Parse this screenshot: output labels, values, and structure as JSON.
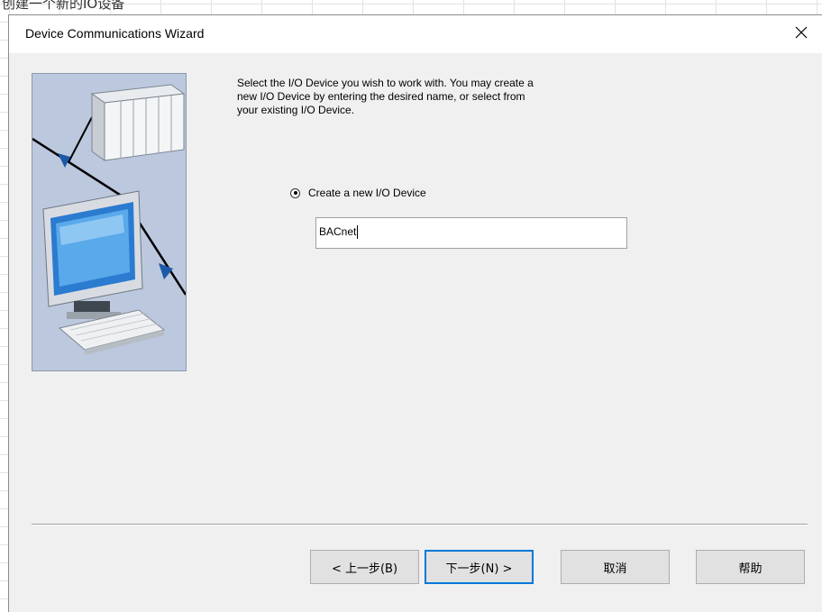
{
  "background": {
    "caption": "创建一个新的IO设备"
  },
  "dialog": {
    "title": "Device Communications Wizard",
    "close_icon": "close-icon",
    "illustration": "network-plc-computer-illustration",
    "instructions": "Select the I/O Device you wish to work with. You may create a\nnew I/O Device by entering the desired name, or select from\nyour existing I/O Device.",
    "option": {
      "label": "Create a new I/O Device",
      "selected": true
    },
    "device_name": "BACnet"
  },
  "buttons": {
    "back": "< 上一步(B)",
    "next": "下一步(N) >",
    "cancel": "取消",
    "help": "帮助"
  },
  "colors": {
    "dialog_bg": "#f0f0f0",
    "illustration_bg": "#bcc8de",
    "default_button_border": "#0078d7"
  }
}
